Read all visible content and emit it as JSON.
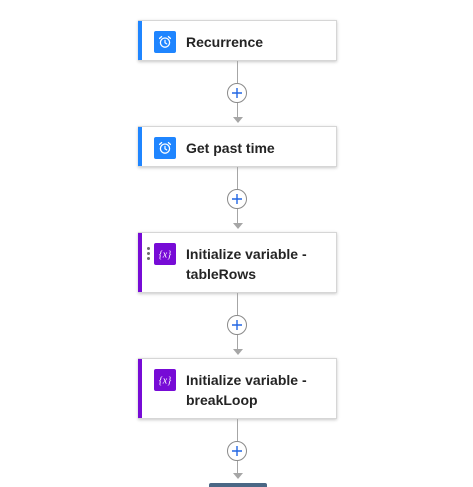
{
  "colors": {
    "schedule_accent": "#1f85ff",
    "variable_accent": "#770bd6",
    "connector": "#a6a6a6"
  },
  "flow": {
    "steps": [
      {
        "title": "Recurrence",
        "icon": "alarm-clock-icon",
        "kind": "schedule"
      },
      {
        "title": "Get past time",
        "icon": "alarm-clock-icon",
        "kind": "schedule"
      },
      {
        "title": "Initialize variable - tableRows",
        "icon": "variable-icon",
        "kind": "variable"
      },
      {
        "title": "Initialize variable - breakLoop",
        "icon": "variable-icon",
        "kind": "variable"
      }
    ]
  }
}
